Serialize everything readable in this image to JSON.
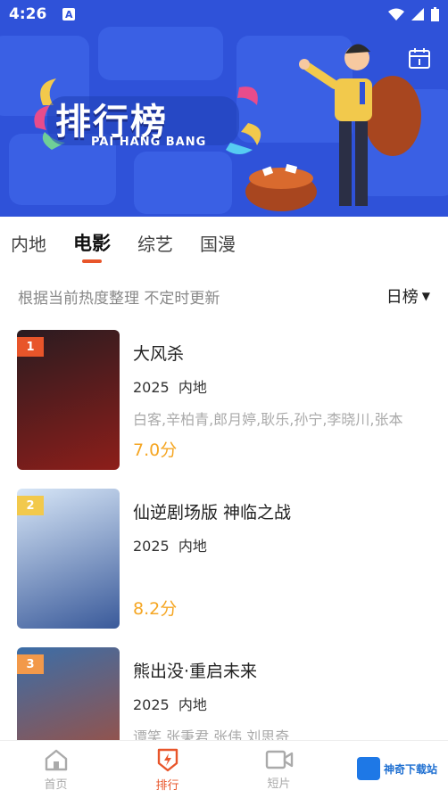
{
  "status_bar": {
    "time": "4:26",
    "a_icon": "A"
  },
  "banner": {
    "title": "排行榜",
    "subtitle": "PAI HANG BANG"
  },
  "tabs": [
    {
      "label": "内地",
      "active": false
    },
    {
      "label": "电影",
      "active": true
    },
    {
      "label": "综艺",
      "active": false
    },
    {
      "label": "国漫",
      "active": false
    }
  ],
  "subheader": {
    "description": "根据当前热度整理 不定时更新",
    "sort_label": "日榜",
    "sort_arrow": "▼"
  },
  "items": [
    {
      "rank": "1",
      "title": "大风杀",
      "year": "2025",
      "region": "内地",
      "cast": "白客,辛柏青,郎月婷,耿乐,孙宁,李晓川,张本",
      "score": "7.0分",
      "rank_color": "#e8552a",
      "poster_colors": [
        "#2a1b20",
        "#8d1e1a"
      ]
    },
    {
      "rank": "2",
      "title": "仙逆剧场版 神临之战",
      "year": "2025",
      "region": "内地",
      "cast": "",
      "score": "8.2分",
      "rank_color": "#f2c94c",
      "poster_colors": [
        "#d7e6f7",
        "#3a5a9a"
      ]
    },
    {
      "rank": "3",
      "title": "熊出没·重启未来",
      "year": "2025",
      "region": "内地",
      "cast": "谭笑,张秉君,张伟,刘思奇",
      "score": "",
      "rank_color": "#f2994a",
      "poster_colors": [
        "#3b6ea8",
        "#b04a2e"
      ]
    }
  ],
  "bottom_nav": [
    {
      "label": "首页",
      "icon": "home-icon",
      "active": false
    },
    {
      "label": "排行",
      "icon": "ranking-icon",
      "active": true
    },
    {
      "label": "短片",
      "icon": "video-icon",
      "active": false
    }
  ],
  "watermark": {
    "text": "神奇下载站"
  }
}
